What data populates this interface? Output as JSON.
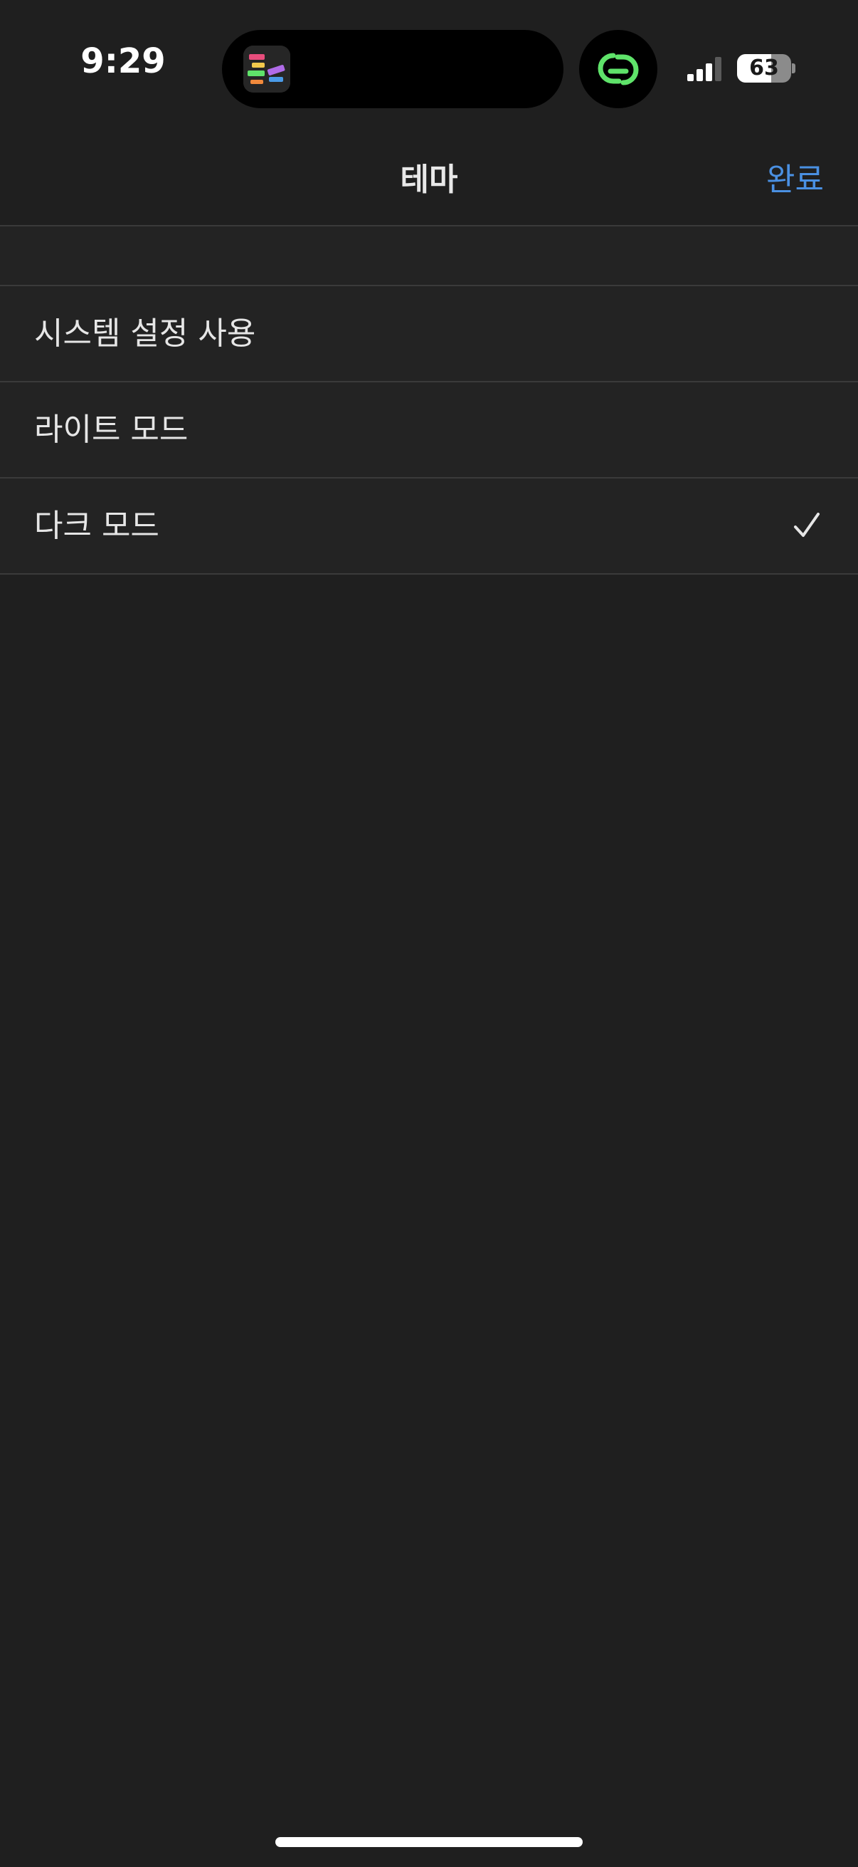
{
  "status_bar": {
    "time": "9:29",
    "battery_level": "63",
    "battery_fraction": 0.63,
    "signal_bars_active": 3,
    "signal_bars_total": 4,
    "link_icon_color": "#5fe36a"
  },
  "nav": {
    "title": "테마",
    "done_label": "완료",
    "accent_color": "#4a90e2"
  },
  "options": [
    {
      "label": "시스템 설정 사용",
      "selected": false
    },
    {
      "label": "라이트 모드",
      "selected": false
    },
    {
      "label": "다크 모드",
      "selected": true
    }
  ],
  "colors": {
    "background": "#1f1f1f",
    "row_background": "#232323",
    "separator": "#3a3a3a",
    "text": "#e6e6e6"
  }
}
